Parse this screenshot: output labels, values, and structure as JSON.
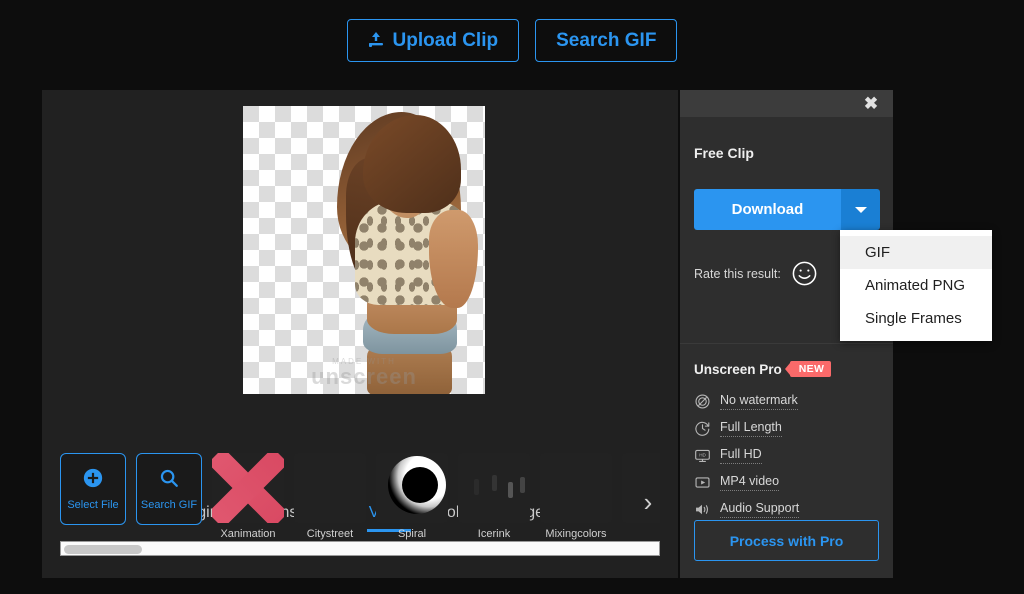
{
  "topbar": {
    "upload_label": "Upload Clip",
    "upload_icon": "upload-icon",
    "search_label": "Search GIF"
  },
  "editor": {
    "watermark_top": "MADE WITH",
    "watermark_main": "unscreen",
    "tabs": [
      {
        "label": "Original",
        "active": false
      },
      {
        "label": "Transparent",
        "active": false
      },
      {
        "label": "Video",
        "active": true
      },
      {
        "label": "Color",
        "active": false
      },
      {
        "label": "Image",
        "active": false
      }
    ],
    "actions": [
      {
        "label": "Select File",
        "icon": "plus-circle-icon"
      },
      {
        "label": "Search GIF",
        "icon": "search-icon"
      }
    ],
    "thumbnails": [
      {
        "label": "Xanimation"
      },
      {
        "label": "Citystreet"
      },
      {
        "label": "Spiral"
      },
      {
        "label": "Icerink"
      },
      {
        "label": "Mixingcolors"
      },
      {
        "label": ""
      }
    ],
    "next_arrow": "chevron-right-icon"
  },
  "sidebar": {
    "close_icon": "close-icon",
    "title": "Free Clip",
    "download_label": "Download",
    "caret_icon": "chevron-down-icon",
    "rate_label": "Rate this result:",
    "rate_icon": "smiley-face-icon",
    "pro": {
      "title": "Unscreen Pro",
      "badge": "NEW",
      "features": [
        {
          "label": "No watermark",
          "icon": "no-watermark-icon"
        },
        {
          "label": "Full Length",
          "icon": "clock-icon"
        },
        {
          "label": "Full HD",
          "icon": "hd-monitor-icon"
        },
        {
          "label": "MP4 video",
          "icon": "play-box-icon"
        },
        {
          "label": "Audio Support",
          "icon": "speaker-icon"
        }
      ],
      "button_label": "Process with Pro"
    }
  },
  "dropdown": {
    "items": [
      {
        "label": "GIF",
        "highlighted": true
      },
      {
        "label": "Animated PNG",
        "highlighted": false
      },
      {
        "label": "Single Frames",
        "highlighted": false
      }
    ]
  },
  "colors": {
    "accent": "#2b95f0",
    "page_bg": "#0d0d0d",
    "panel_bg": "#212121",
    "sidebar_bg": "#2e2e2e",
    "badge_red": "#fa6a6a"
  }
}
